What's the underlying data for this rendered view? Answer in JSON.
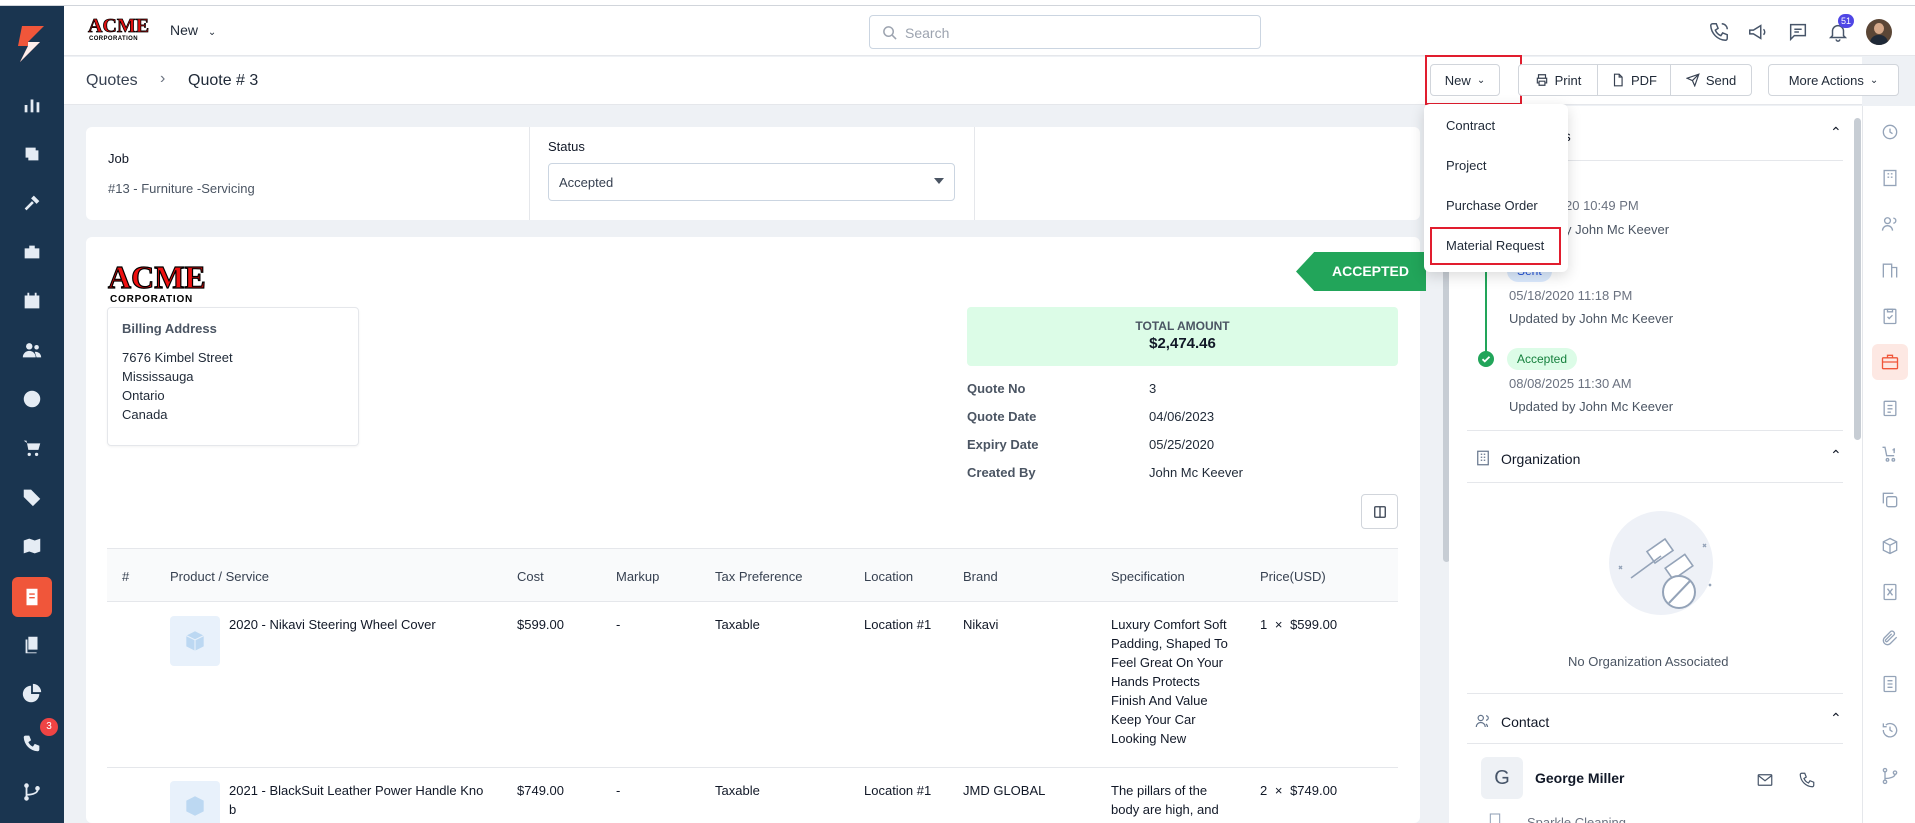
{
  "topbar": {
    "new_label": "New",
    "search_placeholder": "Search",
    "notification_count": "51"
  },
  "nav": {
    "phone_badge": "3"
  },
  "breadcrumb": {
    "parent": "Quotes",
    "current": "Quote # 3"
  },
  "actions": {
    "new_label": "New",
    "print_label": "Print",
    "pdf_label": "PDF",
    "send_label": "Send",
    "more_label": "More Actions"
  },
  "new_menu": {
    "items": [
      "Contract",
      "Project",
      "Purchase Order",
      "Material Request"
    ]
  },
  "summary": {
    "job_label": "Job",
    "job_value": "#13 - Furniture -Servicing",
    "status_label": "Status",
    "status_value": "Accepted"
  },
  "quote": {
    "ribbon": "ACCEPTED",
    "billing_title": "Billing Address",
    "billing_lines": [
      "7676 Kimbel Street",
      "Mississauga",
      "Ontario",
      "Canada"
    ],
    "total_label": "TOTAL AMOUNT",
    "total_value": "$2,474.46",
    "fields": [
      {
        "label": "Quote No",
        "value": "3"
      },
      {
        "label": "Quote Date",
        "value": "04/06/2023"
      },
      {
        "label": "Expiry Date",
        "value": "05/25/2020"
      },
      {
        "label": "Created By",
        "value": "John Mc Keever"
      }
    ]
  },
  "table": {
    "headers": [
      "#",
      "Product / Service",
      "Cost",
      "Markup",
      "Tax Preference",
      "Location",
      "Brand",
      "Specification",
      "Price(USD)"
    ],
    "rows": [
      {
        "product": "2020 - Nikavi Steering Wheel Cover",
        "cost": "$599.00",
        "markup": "-",
        "tax": "Taxable",
        "location": "Location #1",
        "brand": "Nikavi",
        "spec": [
          "Luxury Comfort Soft",
          "Padding, Shaped To",
          "Feel Great On Your",
          "Hands Protects",
          "Finish And Value",
          "Keep Your Car",
          "Looking New"
        ],
        "qty": "1",
        "times": "×",
        "price": "$599.00"
      },
      {
        "product_lines": [
          "2021 - BlackSuit Leather Power Handle Kno",
          "b"
        ],
        "cost": "$749.00",
        "markup": "-",
        "tax": "Taxable",
        "location": "Location #1",
        "brand": "JMD GLOBAL",
        "spec": [
          "The pillars of the",
          "body are high, and"
        ],
        "qty": "2",
        "times": "×",
        "price": "$749.00"
      }
    ]
  },
  "status_panel": {
    "title_fragment": "us",
    "entries": [
      {
        "date": "20 10:49 PM",
        "by": "y John Mc Keever"
      },
      {
        "badge": "Sent",
        "date": "05/18/2020 11:18 PM",
        "by": "Updated by John Mc Keever"
      },
      {
        "badge": "Accepted",
        "date": "08/08/2025 11:30 AM",
        "by": "Updated by John Mc Keever"
      }
    ]
  },
  "organization": {
    "title": "Organization",
    "empty": "No Organization Associated"
  },
  "contact": {
    "title": "Contact",
    "initial": "G",
    "name": "George Miller",
    "org": "Sparkle Cleaning"
  },
  "colors": {
    "nav": "#1a3550",
    "accent": "#f0563a",
    "success": "#22a55a",
    "highlight": "#e11d2e"
  }
}
